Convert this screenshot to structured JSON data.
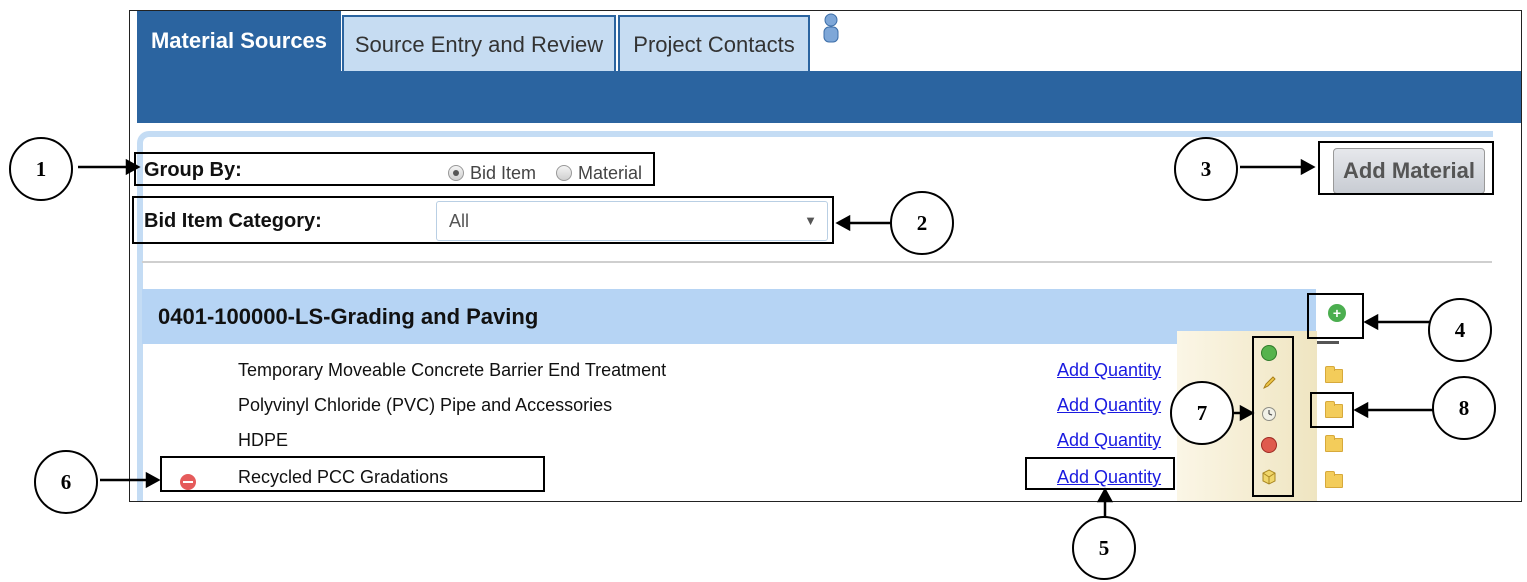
{
  "tabs": [
    {
      "label": "Material Sources"
    },
    {
      "label": "Source Entry and Review"
    },
    {
      "label": "Project Contacts"
    }
  ],
  "form": {
    "group_by_label": "Group By:",
    "group_by_options": [
      "Bid Item",
      "Material"
    ],
    "group_by_selected": "Bid Item",
    "bid_item_category_label": "Bid Item Category:",
    "bid_item_category_value": "All"
  },
  "add_material_label": "Add Material",
  "group": {
    "title": "0401-100000-LS-Grading and Paving",
    "rows": [
      {
        "label": "Temporary Moveable Concrete Barrier End Treatment",
        "action": "Add Quantity"
      },
      {
        "label": "Polyvinyl Chloride (PVC) Pipe and Accessories",
        "action": "Add Quantity"
      },
      {
        "label": "HDPE",
        "action": "Add Quantity"
      },
      {
        "label": "Recycled PCC Gradations",
        "action": "Add Quantity"
      }
    ]
  },
  "status_icons": [
    "check-circle-icon",
    "pencil-icon",
    "clock-icon",
    "error-icon",
    "cube-icon"
  ],
  "annotations": [
    "1",
    "2",
    "3",
    "4",
    "5",
    "6",
    "7",
    "8"
  ],
  "colors": {
    "nav_blue": "#2b64a0",
    "tab_inactive": "#c6dcf2",
    "group_header": "#b6d4f4",
    "link": "#1a1ae0"
  }
}
